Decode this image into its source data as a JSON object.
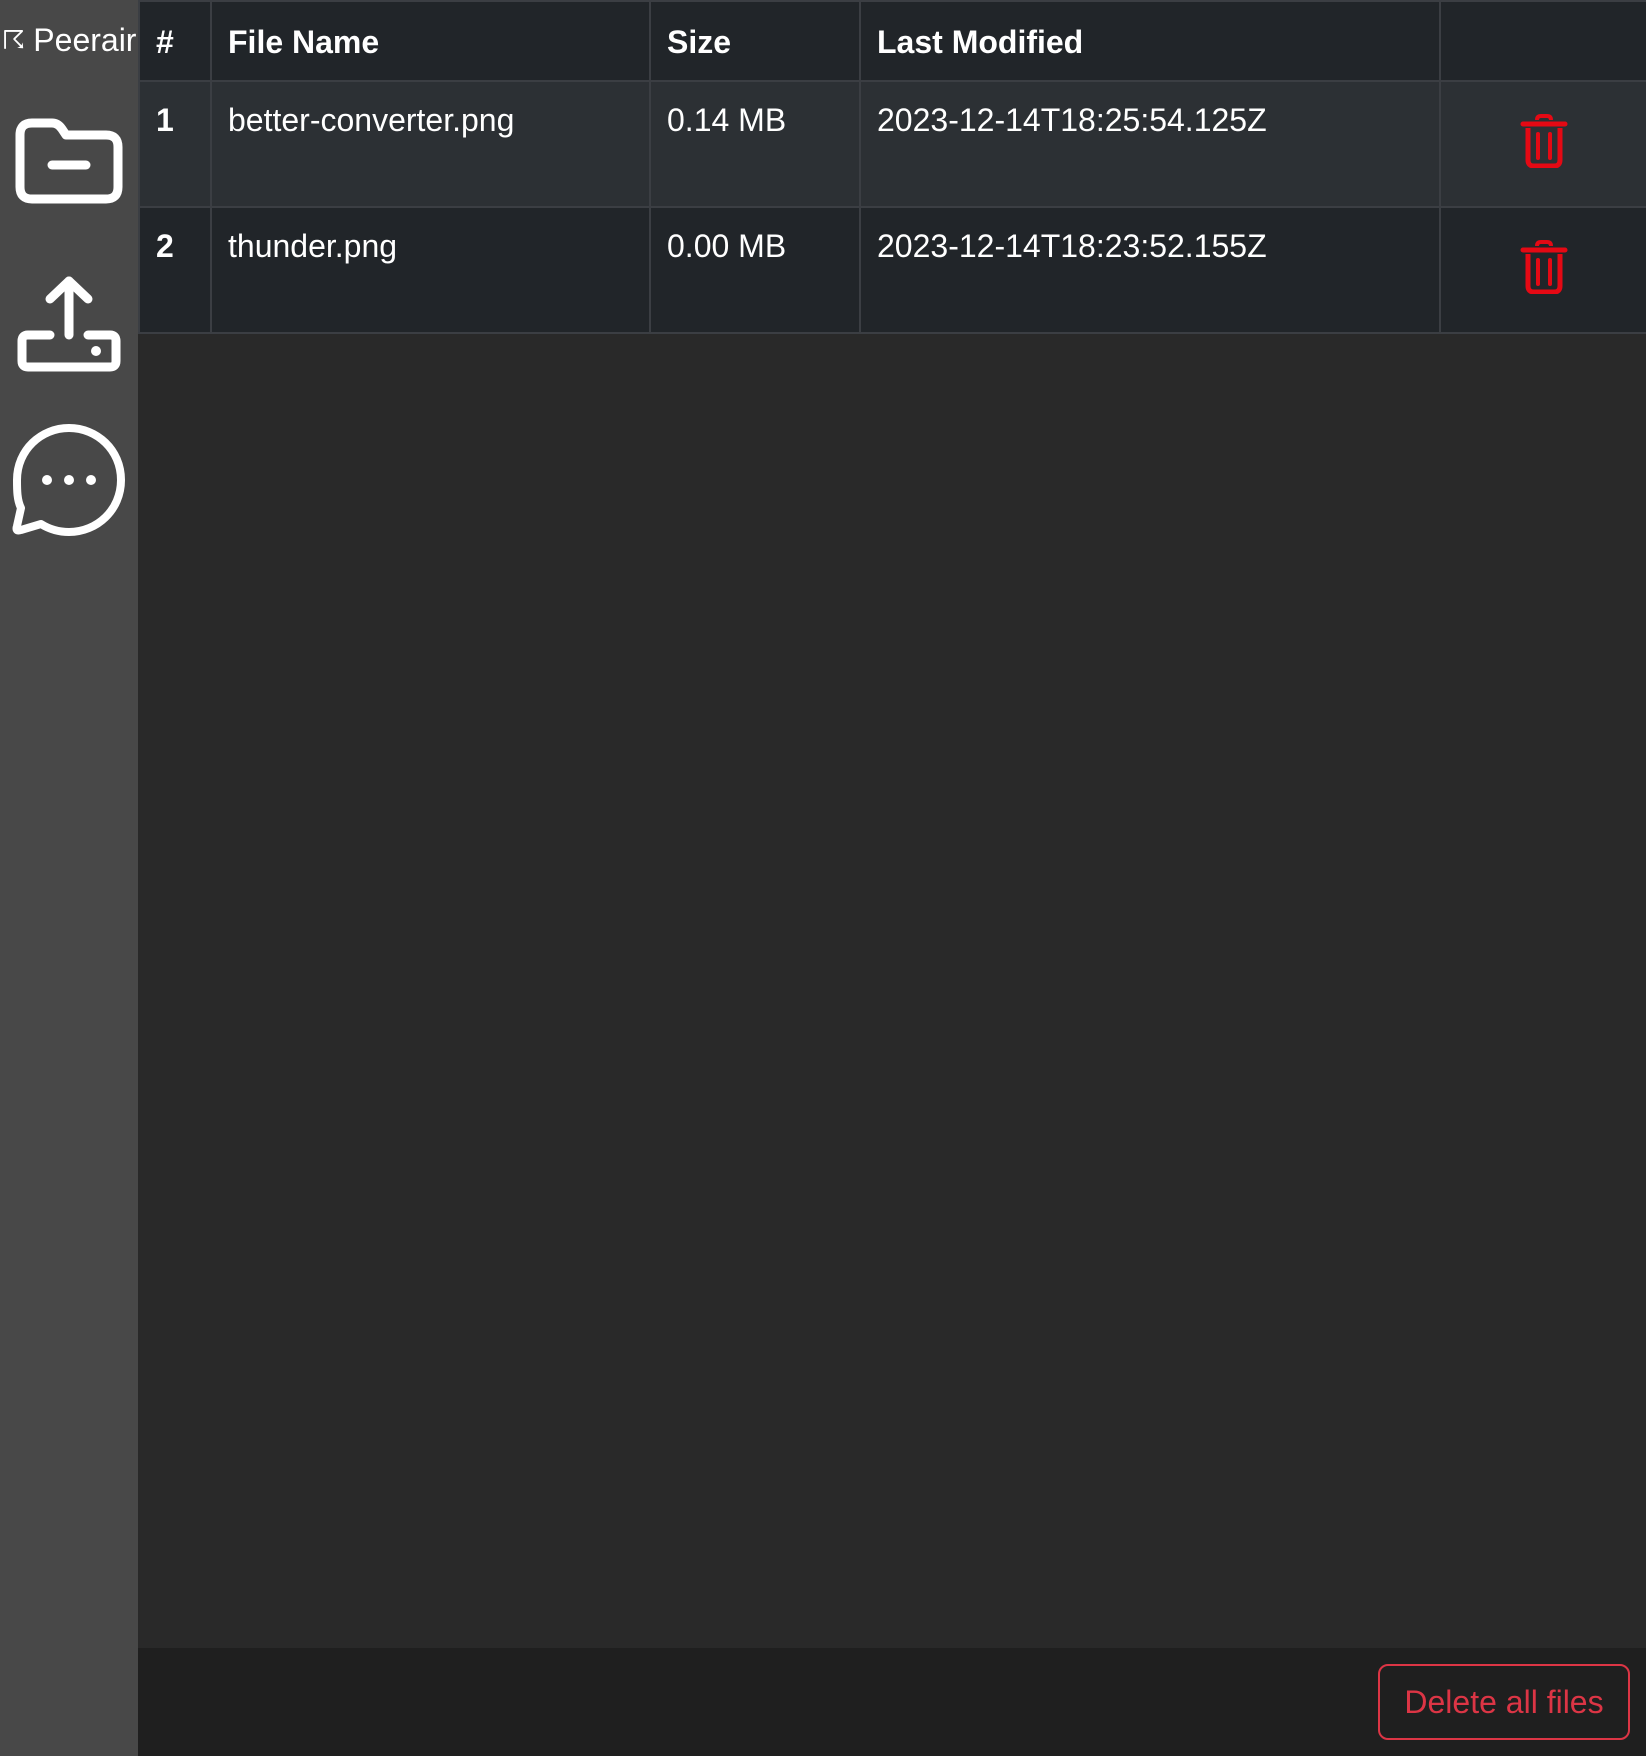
{
  "app": {
    "brand_glyph": "☈",
    "brand_name": "Peerair"
  },
  "sidebar": {
    "items": [
      {
        "name": "files",
        "icon": "folder-minus-icon"
      },
      {
        "name": "upload",
        "icon": "upload-tray-icon"
      },
      {
        "name": "chat",
        "icon": "chat-bubble-dots-icon"
      }
    ]
  },
  "table": {
    "headers": {
      "num": "#",
      "file_name": "File Name",
      "size": "Size",
      "last_modified": "Last Modified",
      "action": ""
    },
    "rows": [
      {
        "num": "1",
        "file_name": "better-converter.png",
        "size": "0.14 MB",
        "last_modified": "2023-12-14T18:25:54.125Z"
      },
      {
        "num": "2",
        "file_name": "thunder.png",
        "size": "0.00 MB",
        "last_modified": "2023-12-14T18:23:52.155Z"
      }
    ]
  },
  "footer": {
    "delete_all_label": "Delete all files"
  },
  "colors": {
    "sidebar_bg": "#484848",
    "main_bg": "#292929",
    "table_header_bg": "#212529",
    "row_odd_bg": "#2c3034",
    "danger": "#dc3545",
    "trash_icon": "#e50914"
  }
}
